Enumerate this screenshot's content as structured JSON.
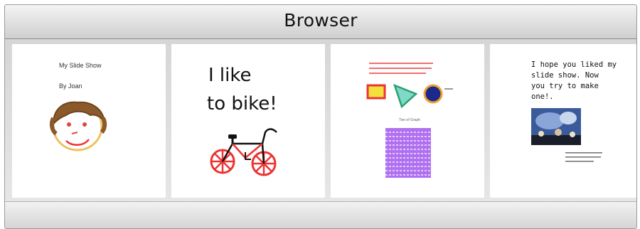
{
  "window": {
    "title": "Browser"
  },
  "slides": [
    {
      "name": "slide-1",
      "title_line": "My Slide Show",
      "byline": "By Joan"
    },
    {
      "name": "slide-2",
      "line1": "I like",
      "line2": "to bike!"
    },
    {
      "name": "slide-3",
      "caption": "Two of Graph"
    },
    {
      "name": "slide-4",
      "line1": "I hope you liked my",
      "line2": "slide show.  Now",
      "line3": "you try to make",
      "line4": "one!."
    }
  ]
}
